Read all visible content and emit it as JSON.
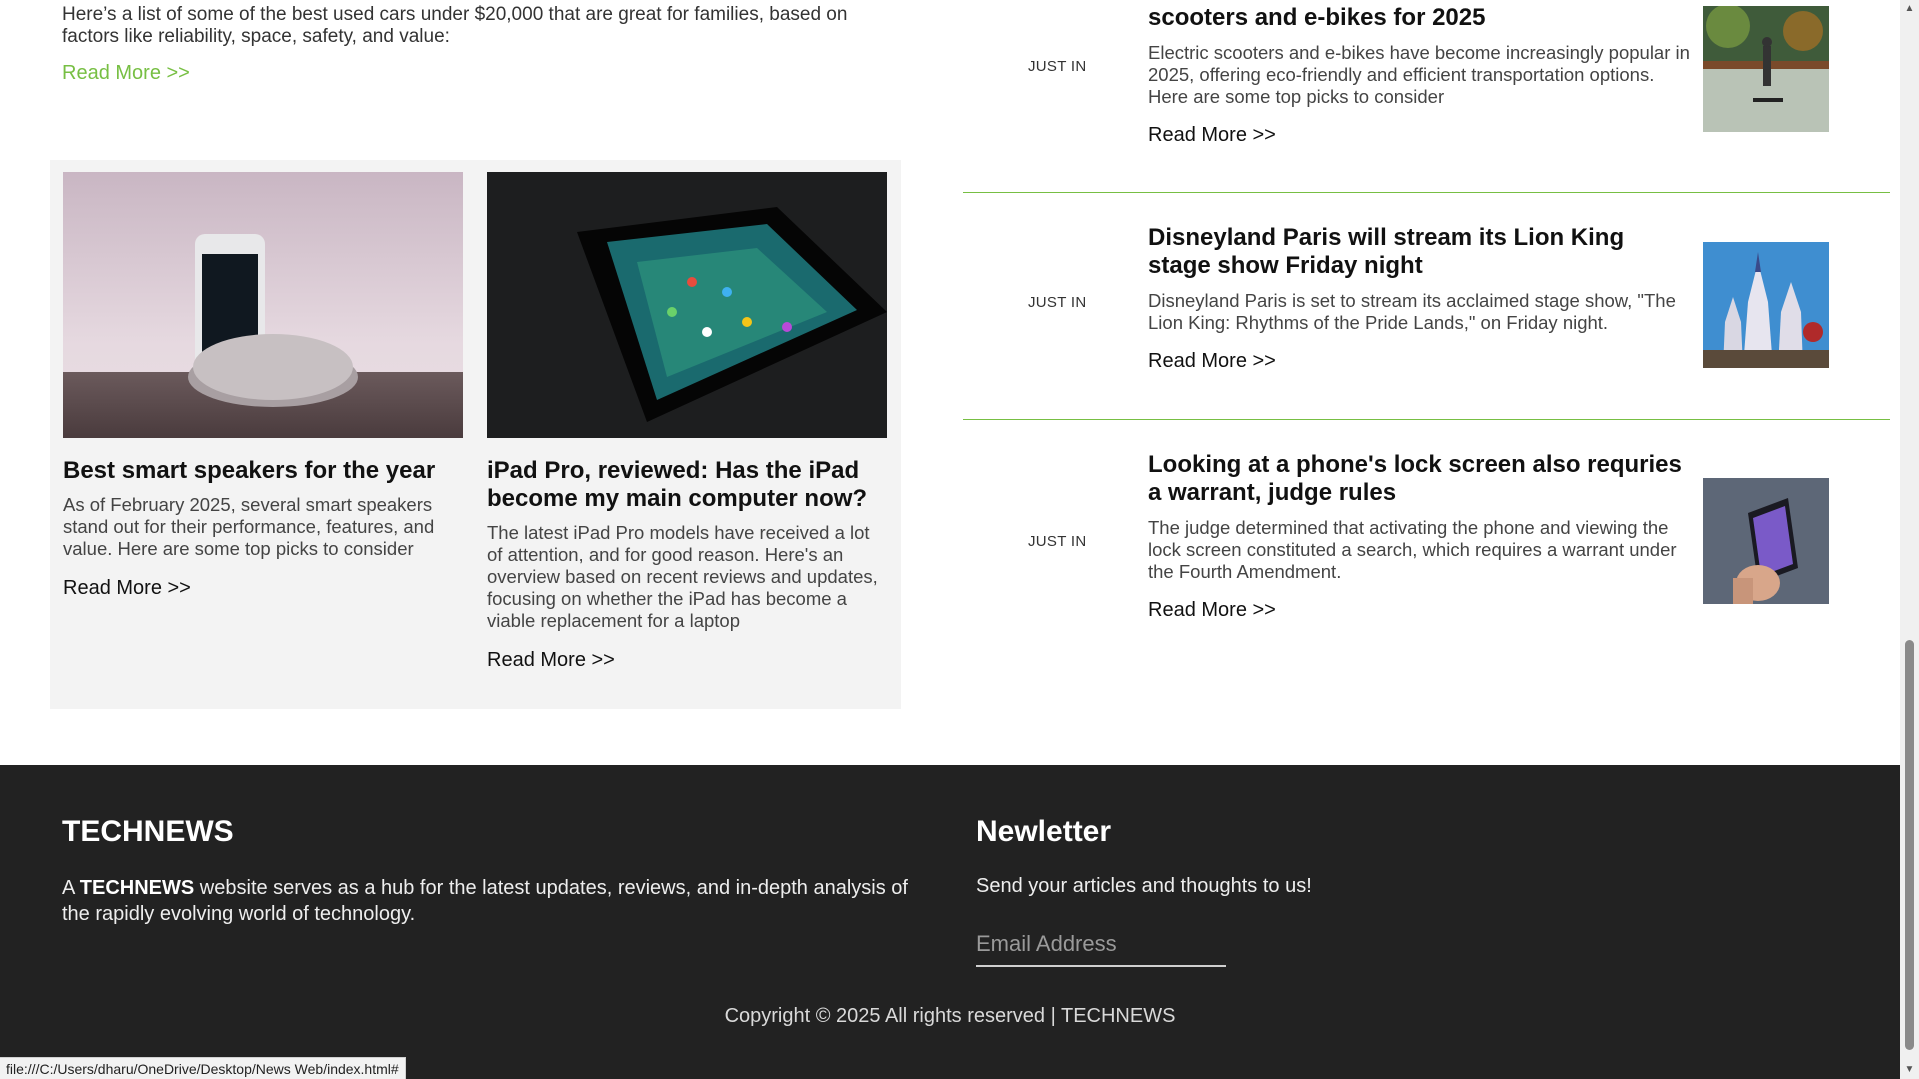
{
  "intro": {
    "text": "Here’s a list of some of the best used cars under $20,000 that are great for families, based on factors like reliability, space, safety, and value:",
    "read_more": "Read More  >>"
  },
  "cards": [
    {
      "title": "Best smart speakers for the year",
      "excerpt": "As of February 2025, several smart speakers stand out for their performance, features, and value. Here are some top picks to consider",
      "read_more": "Read More >>",
      "image": "phone-and-smart-speaker-photo"
    },
    {
      "title": "iPad Pro, reviewed: Has the iPad become my main computer now?",
      "excerpt": "The latest iPad Pro models have received a lot of attention, and for good reason. Here's an overview based on recent reviews and updates, focusing on whether the iPad has become a viable replacement for a laptop",
      "read_more": "Read More >>",
      "image": "ipad-on-dark-table-photo"
    }
  ],
  "side_items": [
    {
      "tag": "JUST IN",
      "title": "scooters and e-bikes for 2025",
      "excerpt": "Electric scooters and e-bikes have become increasingly popular in 2025, offering eco-friendly and efficient transportation options. Here are some top picks to consider",
      "read_more": "Read More >>",
      "image": "scooter-rider-photo"
    },
    {
      "tag": "JUST IN",
      "title": "Disneyland Paris will stream its Lion King stage show Friday night",
      "excerpt": "Disneyland Paris is set to stream its acclaimed stage show, \"The Lion King: Rhythms of the Pride Lands,\" on Friday night.",
      "read_more": "Read More >>",
      "image": "castle-photo"
    },
    {
      "tag": "JUST IN",
      "title": "Looking at a phone's lock screen also requries a warrant, judge rules",
      "excerpt": "The judge determined that activating the phone and viewing the lock screen constituted a search, which requires a warrant under the Fourth Amendment.",
      "read_more": "Read More >>",
      "image": "hand-holding-phone-photo"
    }
  ],
  "footer": {
    "brand": "TECHNEWS",
    "desc_prefix": "A ",
    "desc_brand": "TECHNEWS",
    "desc_suffix": " website serves as a hub for the latest updates, reviews, and in-depth analysis of the rapidly evolving world of technology.",
    "newsletter_title": "Newletter",
    "newsletter_text": "Send your articles and thoughts to us!",
    "email_placeholder": "Email Address",
    "copyright": "Copyright © 2025 All rights reserved | TECHNEWS"
  },
  "status_bar": {
    "url": "file:///C:/Users/dharu/OneDrive/Desktop/News Web/index.html#"
  },
  "colors": {
    "accent": "#77bf43",
    "footer_bg": "#222222",
    "card_bg": "#f3f3f3"
  }
}
